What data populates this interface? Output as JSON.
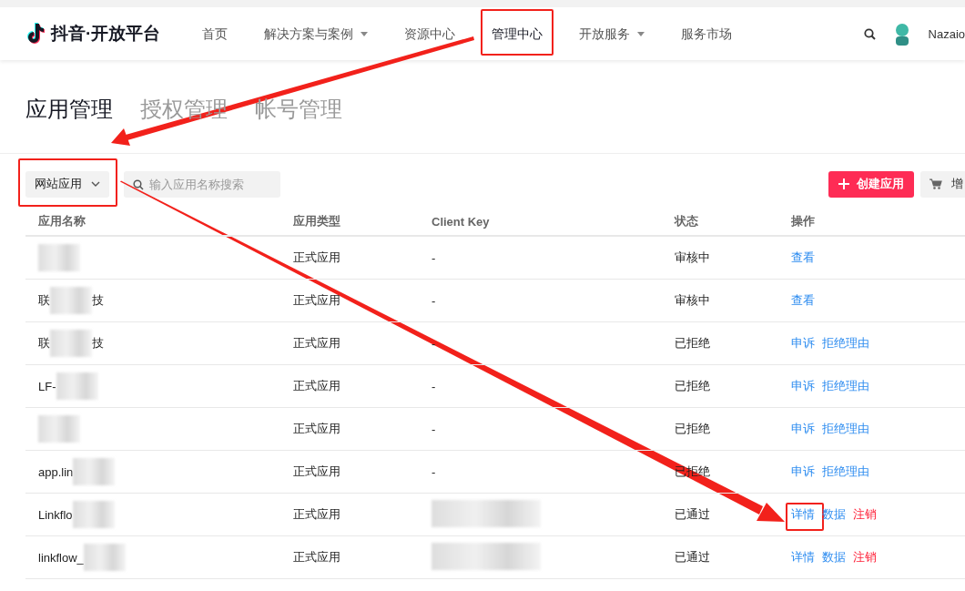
{
  "header": {
    "logo": "抖音·开放平台",
    "nav": [
      {
        "label": "首页",
        "selected": false,
        "has_menu": false,
        "highlighted": false
      },
      {
        "label": "解决方案与案例",
        "selected": false,
        "has_menu": true,
        "highlighted": false
      },
      {
        "label": "资源中心",
        "selected": false,
        "has_menu": false,
        "highlighted": false
      },
      {
        "label": "管理中心",
        "selected": true,
        "has_menu": false,
        "highlighted": true
      },
      {
        "label": "开放服务",
        "selected": false,
        "has_menu": true,
        "highlighted": false
      },
      {
        "label": "服务市场",
        "selected": false,
        "has_menu": false,
        "highlighted": false
      }
    ],
    "user": "Nazaio"
  },
  "tabs": [
    {
      "label": "应用管理",
      "selected": true
    },
    {
      "label": "授权管理",
      "selected": false
    },
    {
      "label": "帐号管理",
      "selected": false
    }
  ],
  "toolbar": {
    "app_type": {
      "value": "网站应用",
      "highlighted": true
    },
    "search": {
      "placeholder": "输入应用名称搜索"
    },
    "create_button": "创建应用",
    "cart_button": "增"
  },
  "table": {
    "columns": [
      "应用名称",
      "应用类型",
      "Client Key",
      "状态",
      "操作"
    ],
    "rows": [
      {
        "type": "正式应用",
        "client_key": "-",
        "status": "审核中",
        "actions": [
          {
            "label": "查看",
            "kind": "link",
            "highlighted": false
          }
        ]
      },
      {
        "name": "联",
        "name_tail": "技",
        "type": "正式应用",
        "client_key": "-",
        "status": "审核中",
        "actions": [
          {
            "label": "查看",
            "kind": "link",
            "highlighted": false
          }
        ]
      },
      {
        "name": "联",
        "name_tail": "技",
        "type": "正式应用",
        "client_key": "-",
        "status": "已拒绝",
        "actions": [
          {
            "label": "申诉",
            "kind": "link",
            "highlighted": false
          },
          {
            "label": "拒绝理由",
            "kind": "link",
            "highlighted": false
          }
        ]
      },
      {
        "name": "LF-",
        "type": "正式应用",
        "client_key": "-",
        "status": "已拒绝",
        "actions": [
          {
            "label": "申诉",
            "kind": "link",
            "highlighted": false
          },
          {
            "label": "拒绝理由",
            "kind": "link",
            "highlighted": false
          }
        ]
      },
      {
        "type": "正式应用",
        "client_key": "-",
        "status": "已拒绝",
        "actions": [
          {
            "label": "申诉",
            "kind": "link",
            "highlighted": false
          },
          {
            "label": "拒绝理由",
            "kind": "link",
            "highlighted": false
          }
        ]
      },
      {
        "name": "app.lin",
        "type": "正式应用",
        "client_key": "-",
        "status": "已拒绝",
        "actions": [
          {
            "label": "申诉",
            "kind": "link",
            "highlighted": false
          },
          {
            "label": "拒绝理由",
            "kind": "link",
            "highlighted": false
          }
        ]
      },
      {
        "name": "Linkflo",
        "type": "正式应用",
        "status": "已通过",
        "actions": [
          {
            "label": "详情",
            "kind": "link",
            "highlighted": true
          },
          {
            "label": "数据",
            "kind": "link",
            "highlighted": false
          },
          {
            "label": "注销",
            "kind": "danger",
            "highlighted": false
          }
        ]
      },
      {
        "name": "linkflow_",
        "type": "正式应用",
        "status": "已通过",
        "actions": [
          {
            "label": "详情",
            "kind": "link",
            "highlighted": false
          },
          {
            "label": "数据",
            "kind": "link",
            "highlighted": false
          },
          {
            "label": "注销",
            "kind": "danger",
            "highlighted": false
          }
        ]
      }
    ]
  }
}
